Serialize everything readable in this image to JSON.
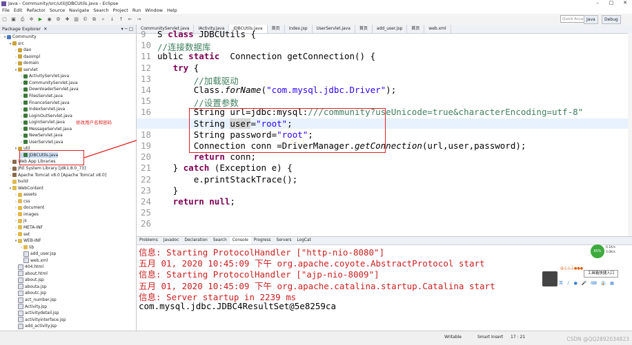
{
  "window": {
    "title": "Java - Community/src/util/JDBCUtils.java - Eclipse"
  },
  "menu": [
    "File",
    "Edit",
    "Refactor",
    "Source",
    "Navigate",
    "Search",
    "Project",
    "Run",
    "Window",
    "Help"
  ],
  "toolbar": {
    "quick_access": "Quick Access",
    "perspectives": [
      "Java",
      "Debug"
    ]
  },
  "explorer": {
    "title": "Package Explorer",
    "annotation": "修改用户名和密码",
    "items": [
      {
        "label": "Community",
        "indent": 0,
        "icon": "proj",
        "tw": "▾"
      },
      {
        "label": "src",
        "indent": 1,
        "icon": "pkg",
        "tw": "▾"
      },
      {
        "label": "dao",
        "indent": 2,
        "icon": "pkg",
        "tw": "›"
      },
      {
        "label": "daoimpl",
        "indent": 2,
        "icon": "pkg",
        "tw": "›"
      },
      {
        "label": "domain",
        "indent": 2,
        "icon": "pkg",
        "tw": "›"
      },
      {
        "label": "servlet",
        "indent": 2,
        "icon": "pkg",
        "tw": "▾"
      },
      {
        "label": "ActivityServlet.java",
        "indent": 3,
        "icon": "java",
        "tw": "›"
      },
      {
        "label": "CommunityServlet.java",
        "indent": 3,
        "icon": "java",
        "tw": "›"
      },
      {
        "label": "DownloaderServlet.java",
        "indent": 3,
        "icon": "java",
        "tw": "›"
      },
      {
        "label": "FilesServlet.java",
        "indent": 3,
        "icon": "java",
        "tw": "›"
      },
      {
        "label": "FinanceServlet.java",
        "indent": 3,
        "icon": "java",
        "tw": "›"
      },
      {
        "label": "IndexServlet.java",
        "indent": 3,
        "icon": "java",
        "tw": "›"
      },
      {
        "label": "LoginOutServlet.java",
        "indent": 3,
        "icon": "java",
        "tw": "›"
      },
      {
        "label": "LoginServlet.java",
        "indent": 3,
        "icon": "java",
        "tw": "›"
      },
      {
        "label": "MessageServlet.java",
        "indent": 3,
        "icon": "java",
        "tw": "›"
      },
      {
        "label": "NewServlet.java",
        "indent": 3,
        "icon": "java",
        "tw": "›"
      },
      {
        "label": "UserServlet.java",
        "indent": 3,
        "icon": "java",
        "tw": "›"
      },
      {
        "label": "util",
        "indent": 2,
        "icon": "pkg",
        "tw": "▾"
      },
      {
        "label": "JDBCUtils.java",
        "indent": 3,
        "icon": "java",
        "tw": "›",
        "selected": true
      },
      {
        "label": "Web App Libraries",
        "indent": 1,
        "icon": "lib",
        "tw": "›"
      },
      {
        "label": "JRE System Library [jdk1.8.0_73]",
        "indent": 1,
        "icon": "lib",
        "tw": "›"
      },
      {
        "label": "Apache Tomcat v8.0 [Apache Tomcat v8.0]",
        "indent": 1,
        "icon": "lib",
        "tw": "›"
      },
      {
        "label": "build",
        "indent": 1,
        "icon": "folder",
        "tw": ""
      },
      {
        "label": "WebContent",
        "indent": 1,
        "icon": "folder",
        "tw": "▾"
      },
      {
        "label": "assets",
        "indent": 2,
        "icon": "folder",
        "tw": "›"
      },
      {
        "label": "css",
        "indent": 2,
        "icon": "folder",
        "tw": "›"
      },
      {
        "label": "document",
        "indent": 2,
        "icon": "folder",
        "tw": "›"
      },
      {
        "label": "images",
        "indent": 2,
        "icon": "folder",
        "tw": "›"
      },
      {
        "label": "js",
        "indent": 2,
        "icon": "folder",
        "tw": "›"
      },
      {
        "label": "META-INF",
        "indent": 2,
        "icon": "folder",
        "tw": "›"
      },
      {
        "label": "set",
        "indent": 2,
        "icon": "folder",
        "tw": "›"
      },
      {
        "label": "WEB-INF",
        "indent": 2,
        "icon": "folder",
        "tw": "▾"
      },
      {
        "label": "lib",
        "indent": 3,
        "icon": "folder",
        "tw": "›"
      },
      {
        "label": "add_user.jsp",
        "indent": 3,
        "icon": "file",
        "tw": ""
      },
      {
        "label": "web.xml",
        "indent": 3,
        "icon": "file",
        "tw": ""
      },
      {
        "label": "404.html",
        "indent": 2,
        "icon": "file",
        "tw": ""
      },
      {
        "label": "about.html",
        "indent": 2,
        "icon": "file",
        "tw": ""
      },
      {
        "label": "about.jsp",
        "indent": 2,
        "icon": "file",
        "tw": ""
      },
      {
        "label": "abouta.jsp",
        "indent": 2,
        "icon": "file",
        "tw": ""
      },
      {
        "label": "aboutc.jsp",
        "indent": 2,
        "icon": "file",
        "tw": ""
      },
      {
        "label": "act_number.jsp",
        "indent": 2,
        "icon": "file",
        "tw": ""
      },
      {
        "label": "Activity.jsp",
        "indent": 2,
        "icon": "file",
        "tw": ""
      },
      {
        "label": "activitydetail.jsp",
        "indent": 2,
        "icon": "file",
        "tw": ""
      },
      {
        "label": "activityinterface.jsp",
        "indent": 2,
        "icon": "file",
        "tw": ""
      },
      {
        "label": "add_activity.jsp",
        "indent": 2,
        "icon": "file",
        "tw": ""
      }
    ]
  },
  "editor": {
    "tabs": [
      "CommunityServlet.java",
      "IActivity.java",
      "JDBCUtils.java",
      "首页",
      "index.jsp",
      "UserServlet.java",
      "首页",
      "add_user.jsp",
      "首页",
      "web.xml"
    ],
    "active_tab": 2,
    "line_numbers": [
      "9",
      "10",
      "11",
      "12",
      "13",
      "14",
      "15",
      "16",
      "17",
      "18",
      "19",
      "20",
      "21",
      "22",
      "23",
      "24",
      "25",
      "26"
    ],
    "lines": [
      "S class JDBCUtils {",
      "//连接数据库",
      "ublic static  Connection getConnection() {",
      "   try {",
      "       //加载驱动",
      "       Class.forName(\"com.mysql.jdbc.Driver\");",
      "       //设置参数",
      "       String url=\"jdbc:mysql:///community?useUnicode=true&characterEncoding=utf-8\"",
      "       String user=\"root\";",
      "       String password=\"root\";",
      "       Connection conn =DriverManager.getConnection(url,user,password);",
      "       return conn;",
      "   } catch (Exception e) {",
      "       e.printStackTrace();",
      "   }",
      "   return null;",
      "",
      ""
    ]
  },
  "console": {
    "tabs": [
      "Problems",
      "Javadoc",
      "Declaration",
      "Search",
      "Console",
      "Progress",
      "Servers",
      "LogCat"
    ],
    "active_tab": 4,
    "lines": [
      {
        "text": "信息: Starting ProtocolHandler [\"http-nio-8080\"]",
        "color": "red"
      },
      {
        "text": "五月 01, 2020 10:45:09 下午 org.apache.coyote.AbstractProtocol start",
        "color": "red"
      },
      {
        "text": "信息: Starting ProtocolHandler [\"ajp-nio-8009\"]",
        "color": "red"
      },
      {
        "text": "五月 01, 2020 10:45:09 下午 org.apache.catalina.startup.Catalina start",
        "color": "red"
      },
      {
        "text": "信息: Server startup in 2239 ms",
        "color": "red"
      },
      {
        "text": "com.mysql.jdbc.JDBC4ResultSet@5e8259ca",
        "color": "black"
      }
    ]
  },
  "widget": {
    "percent": "65%",
    "up": "0.1K/s",
    "down": "0.0K/s"
  },
  "helper": {
    "title": "@ふふふ●●●",
    "button": "工具箱快捷入口",
    "icons": "英 ♪ ● 🎤 ⌨ 👔 ▦"
  },
  "status": {
    "mode": "Writable",
    "insert": "Smart Insert",
    "position": "17 : 21"
  },
  "watermark": "CSDN @QQ2892034823"
}
